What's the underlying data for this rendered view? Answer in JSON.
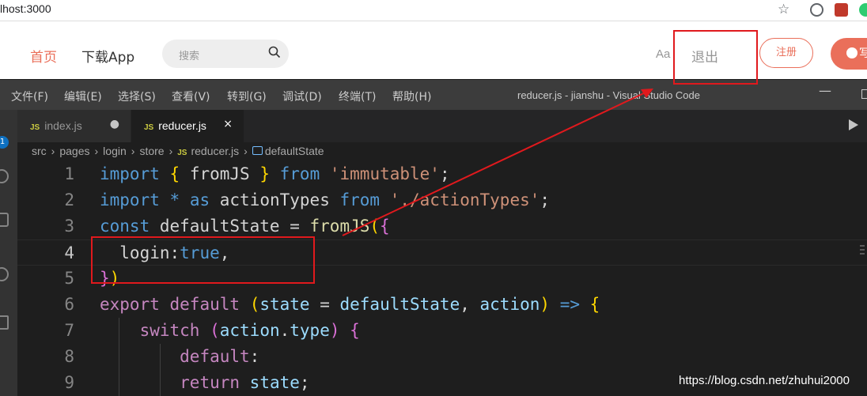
{
  "browser": {
    "url": "lhost:3000"
  },
  "site": {
    "nav": [
      "首页",
      "下载App"
    ],
    "search_placeholder": "搜索",
    "font_toggle": "Aa",
    "logout": "退出",
    "register": "注册",
    "write": "写"
  },
  "vscode": {
    "menu": [
      "文件(F)",
      "编辑(E)",
      "选择(S)",
      "查看(V)",
      "转到(G)",
      "调试(D)",
      "终端(T)",
      "帮助(H)"
    ],
    "window_title": "reducer.js - jianshu - Visual Studio Code",
    "activity_badge": "1",
    "tabs": [
      {
        "badge": "JS",
        "label": "index.js",
        "status": "●"
      },
      {
        "badge": "JS",
        "label": "reducer.js",
        "status": "×"
      }
    ],
    "breadcrumbs": [
      "src",
      "pages",
      "login",
      "store",
      "reducer.js",
      "defaultState"
    ],
    "breadcrumb_separator": "›",
    "code_lines": [
      {
        "n": "1",
        "tokens": [
          [
            "kw",
            "import"
          ],
          [
            "plain",
            " "
          ],
          [
            "br1",
            "{"
          ],
          [
            "plain",
            " fromJS "
          ],
          [
            "br1",
            "}"
          ],
          [
            "plain",
            " "
          ],
          [
            "kw",
            "from"
          ],
          [
            "plain",
            " "
          ],
          [
            "str",
            "'immutable'"
          ],
          [
            "plain",
            ";"
          ]
        ]
      },
      {
        "n": "2",
        "tokens": [
          [
            "kw",
            "import"
          ],
          [
            "plain",
            " "
          ],
          [
            "kw",
            "*"
          ],
          [
            "plain",
            " "
          ],
          [
            "kw",
            "as"
          ],
          [
            "plain",
            " actionTypes "
          ],
          [
            "kw",
            "from"
          ],
          [
            "plain",
            " "
          ],
          [
            "str",
            "'./actionTypes'"
          ],
          [
            "plain",
            ";"
          ]
        ]
      },
      {
        "n": "3",
        "tokens": [
          [
            "kw",
            "const"
          ],
          [
            "plain",
            " defaultState = "
          ],
          [
            "fn",
            "fromJS"
          ],
          [
            "br1",
            "("
          ],
          [
            "br2",
            "{"
          ]
        ]
      },
      {
        "n": "4",
        "tokens": [
          [
            "plain",
            "  login:"
          ],
          [
            "kw",
            "true"
          ],
          [
            "plain",
            ","
          ]
        ]
      },
      {
        "n": "5",
        "tokens": [
          [
            "br2",
            "}"
          ],
          [
            "br1",
            ")"
          ]
        ]
      },
      {
        "n": "6",
        "tokens": [
          [
            "kw2",
            "export"
          ],
          [
            "plain",
            " "
          ],
          [
            "kw2",
            "default"
          ],
          [
            "plain",
            " "
          ],
          [
            "br1",
            "("
          ],
          [
            "var",
            "state"
          ],
          [
            "plain",
            " = "
          ],
          [
            "var",
            "defaultState"
          ],
          [
            "plain",
            ", "
          ],
          [
            "var",
            "action"
          ],
          [
            "br1",
            ")"
          ],
          [
            "plain",
            " "
          ],
          [
            "kw",
            "=>"
          ],
          [
            "plain",
            " "
          ],
          [
            "br1",
            "{"
          ]
        ]
      },
      {
        "n": "7",
        "tokens": [
          [
            "plain",
            "    "
          ],
          [
            "kw2",
            "switch"
          ],
          [
            "plain",
            " "
          ],
          [
            "br2",
            "("
          ],
          [
            "var",
            "action"
          ],
          [
            "plain",
            "."
          ],
          [
            "var",
            "type"
          ],
          [
            "br2",
            ")"
          ],
          [
            "plain",
            " "
          ],
          [
            "br2",
            "{"
          ]
        ]
      },
      {
        "n": "8",
        "tokens": [
          [
            "plain",
            "        "
          ],
          [
            "kw2",
            "default"
          ],
          [
            "plain",
            ":"
          ]
        ]
      },
      {
        "n": "9",
        "tokens": [
          [
            "plain",
            "        "
          ],
          [
            "kw2",
            "return"
          ],
          [
            "plain",
            " "
          ],
          [
            "var",
            "state"
          ],
          [
            "plain",
            ";"
          ]
        ]
      }
    ]
  },
  "watermark": "https://blog.csdn.net/zhuhui2000",
  "colors": {
    "accent": "#ea6f5a",
    "annotation": "#e0191d",
    "editor_bg": "#1e1e1e"
  }
}
